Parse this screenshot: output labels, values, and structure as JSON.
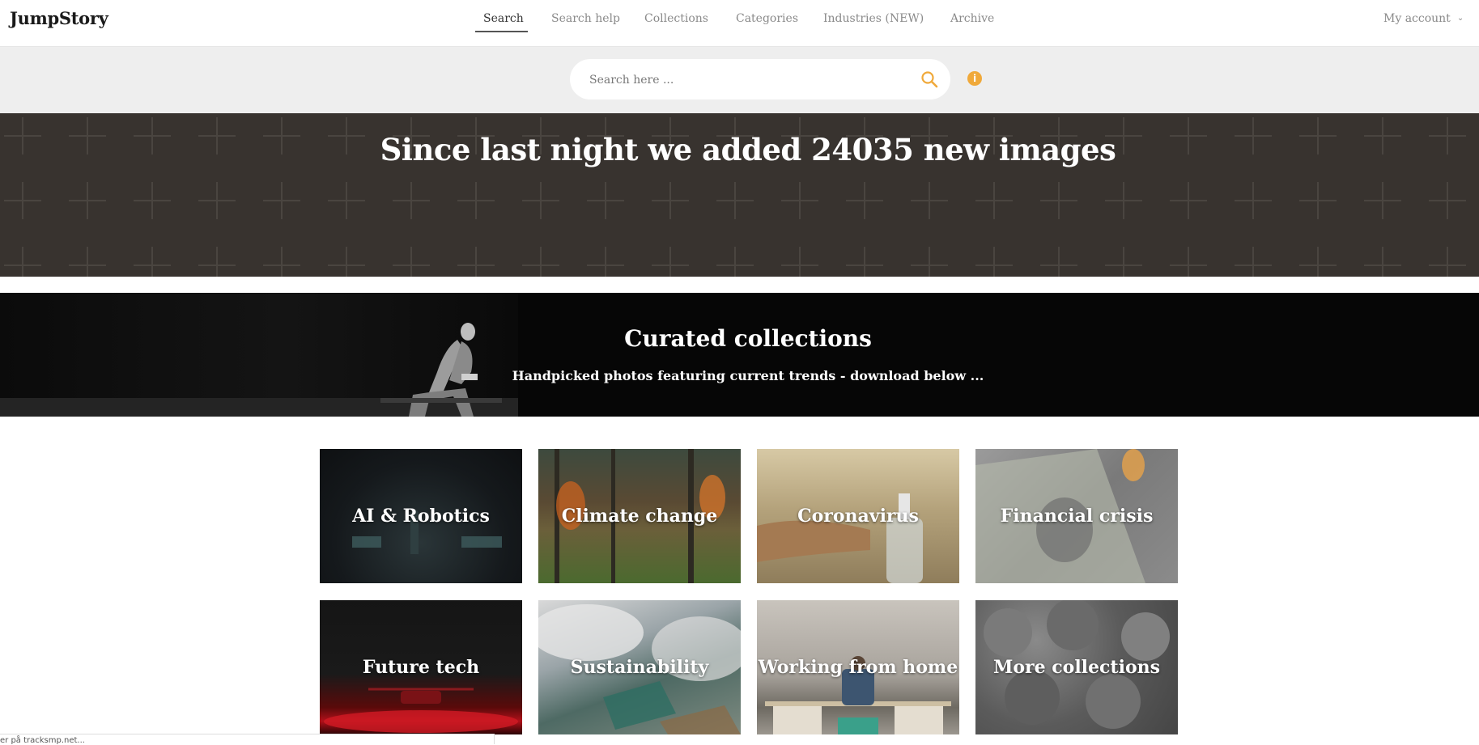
{
  "header": {
    "logo": "JumpStory",
    "nav": [
      "Search",
      "Search help",
      "Collections",
      "Categories",
      "Industries (NEW)",
      "Archive"
    ],
    "active_nav": "Search",
    "account_label": "My account"
  },
  "search": {
    "placeholder": "Search here ...",
    "value": ""
  },
  "hero": {
    "headline": "Since last night we added 24035 new images"
  },
  "curated": {
    "title": "Curated collections",
    "subtitle": "Handpicked photos featuring current trends - download below ..."
  },
  "collections": [
    "AI & Robotics",
    "Climate change",
    "Coronavirus",
    "Financial crisis",
    "Future tech",
    "Sustainability",
    "Working from home",
    "More collections"
  ],
  "status_bar": {
    "text": "er på tracksmp.net..."
  },
  "colors": {
    "accent": "#f0a93a",
    "hero_bg": "#38332f",
    "curated_bg": "#060606",
    "search_band_bg": "#eeeeee"
  },
  "icons": [
    "search-icon",
    "info-icon",
    "chevron-down-icon"
  ]
}
